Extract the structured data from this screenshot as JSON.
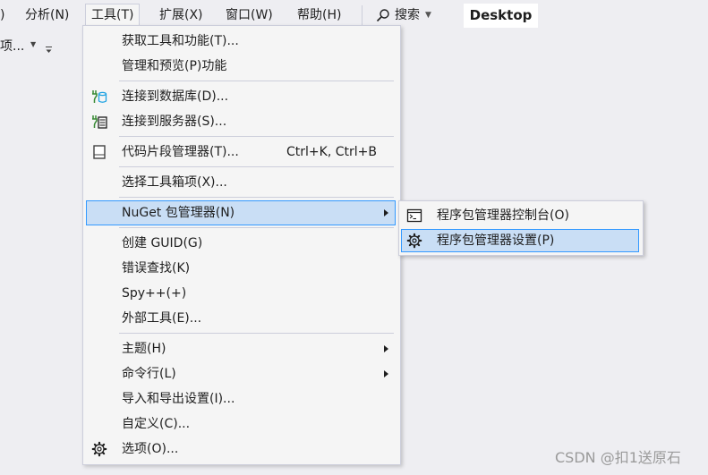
{
  "menubar": {
    "items": [
      {
        "label": ")"
      },
      {
        "label": "分析(N)"
      },
      {
        "label": "工具(T)"
      },
      {
        "label": "扩展(X)"
      },
      {
        "label": "窗口(W)"
      },
      {
        "label": "帮助(H)"
      }
    ],
    "search_label": "搜索",
    "desktop_label": "Desktop"
  },
  "toolbar": {
    "truncated_text": "项..."
  },
  "tools_menu": {
    "items": [
      {
        "label": "获取工具和功能(T)...",
        "icon": ""
      },
      {
        "label": "管理和预览(P)功能",
        "icon": ""
      },
      {
        "label": "连接到数据库(D)...",
        "icon": "database-connect-icon"
      },
      {
        "label": "连接到服务器(S)...",
        "icon": "server-connect-icon"
      },
      {
        "label": "代码片段管理器(T)...",
        "shortcut": "Ctrl+K, Ctrl+B",
        "icon": "code-snippet-icon"
      },
      {
        "label": "选择工具箱项(X)...",
        "icon": ""
      },
      {
        "label": "NuGet 包管理器(N)",
        "submenu": true,
        "icon": ""
      },
      {
        "label": "创建 GUID(G)",
        "icon": ""
      },
      {
        "label": "错误查找(K)",
        "icon": ""
      },
      {
        "label": "Spy++(+)",
        "icon": ""
      },
      {
        "label": "外部工具(E)...",
        "icon": ""
      },
      {
        "label": "主题(H)",
        "submenu": true,
        "icon": ""
      },
      {
        "label": "命令行(L)",
        "submenu": true,
        "icon": ""
      },
      {
        "label": "导入和导出设置(I)...",
        "icon": ""
      },
      {
        "label": "自定义(C)...",
        "icon": ""
      },
      {
        "label": "选项(O)...",
        "icon": "gear-icon"
      }
    ]
  },
  "nuget_submenu": {
    "items": [
      {
        "label": "程序包管理器控制台(O)",
        "icon": "console-icon"
      },
      {
        "label": "程序包管理器设置(P)",
        "icon": "gear-icon"
      }
    ]
  },
  "colors": {
    "background": "#eeeef2",
    "menu_background": "#f5f5f5",
    "highlight": "#c9def5",
    "highlight_border": "#3399ff",
    "icon_green": "#388a34",
    "icon_blue": "#1ba1e2"
  },
  "watermark": "CSDN @扣1送原石"
}
